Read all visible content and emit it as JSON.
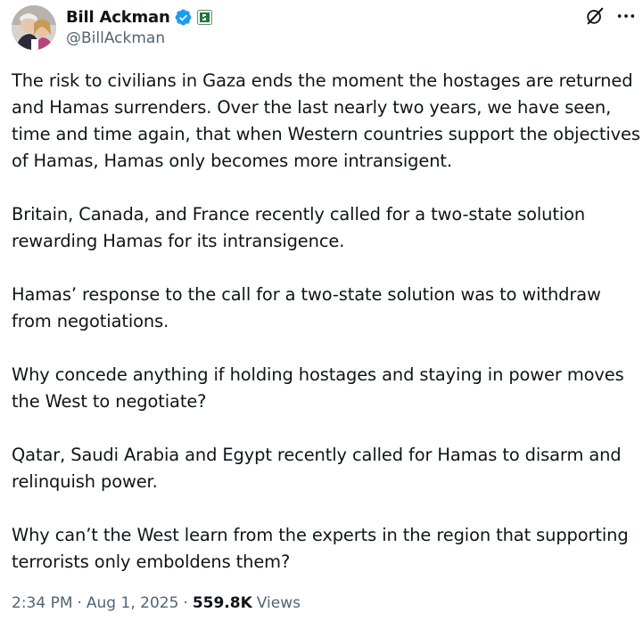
{
  "author": {
    "display_name": "Bill Ackman",
    "handle": "@BillAckman",
    "verified_color": "#1d9bf0",
    "affiliate_color": "#1a7a3a"
  },
  "paragraphs": [
    "The risk to civilians in Gaza ends the moment the hostages are returned and Hamas surrenders. Over the last nearly two years, we have seen, time and time again, that when Western countries support the objectives of Hamas, Hamas only becomes more intransigent.",
    "Britain, Canada, and France recently called for a two-state solution rewarding Hamas for its intransigence.",
    "Hamas’ response to the call for a two-state solution was to withdraw from negotiations.",
    "Why concede anything if holding hostages and staying in power moves the West to negotiate?",
    "Qatar, Saudi Arabia and Egypt recently called for Hamas to disarm and relinquish power.",
    "Why can’t the West learn from the experts in the region that supporting terrorists only emboldens them?"
  ],
  "meta": {
    "time": "2:34 PM",
    "separator": "·",
    "date": "Aug 1, 2025",
    "views_count": "559.8K",
    "views_label": "Views"
  },
  "icons": {
    "verified": "verified-badge-icon",
    "affiliate": "affiliate-badge-icon",
    "grok": "grok-icon",
    "more": "more-icon"
  }
}
